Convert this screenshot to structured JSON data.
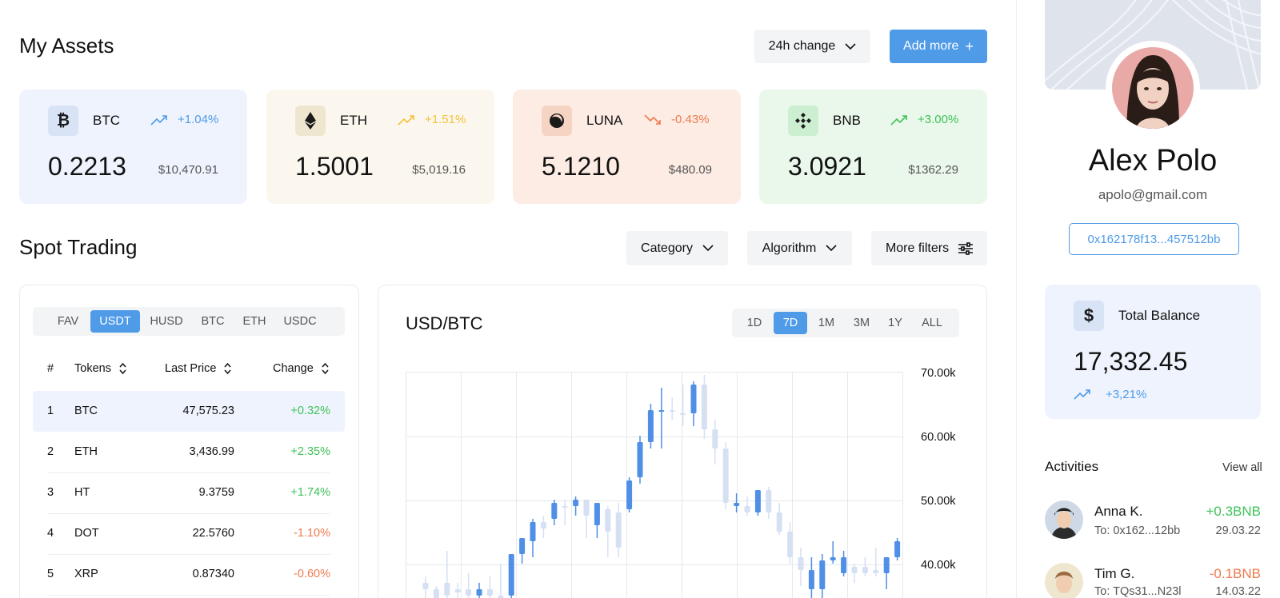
{
  "assets": {
    "title": "My Assets",
    "change_filter": "24h change",
    "add_more": "Add more",
    "cards": [
      {
        "symbol": "BTC",
        "change": "+1.04%",
        "amount": "0.2213",
        "usd": "$10,470.91",
        "icon": "bitcoin-icon",
        "bg": "#eef3fd",
        "icon_bg": "#d8e3f6",
        "accent": "#4f9be8",
        "dir": "up"
      },
      {
        "symbol": "ETH",
        "change": "+1.51%",
        "amount": "1.5001",
        "usd": "$5,019.16",
        "icon": "ethereum-icon",
        "bg": "#fbf7ee",
        "icon_bg": "#efe6d0",
        "accent": "#f3c23b",
        "dir": "up"
      },
      {
        "symbol": "LUNA",
        "change": "-0.43%",
        "amount": "5.1210",
        "usd": "$480.09",
        "icon": "luna-icon",
        "bg": "#fdece4",
        "icon_bg": "#f6d4c4",
        "accent": "#ef7a4f",
        "dir": "down"
      },
      {
        "symbol": "BNB",
        "change": "+3.00%",
        "amount": "3.0921",
        "usd": "$1362.29",
        "icon": "bnb-icon",
        "bg": "#e9f8ea",
        "icon_bg": "#cdefd1",
        "accent": "#3fc25a",
        "dir": "up"
      }
    ]
  },
  "spot": {
    "title": "Spot Trading",
    "filters": {
      "category": "Category",
      "algorithm": "Algorithm",
      "more": "More filters"
    },
    "tabs": [
      "FAV",
      "USDT",
      "HUSD",
      "BTC",
      "ETH",
      "USDC"
    ],
    "active_tab": "USDT",
    "columns": {
      "num": "#",
      "tokens": "Tokens",
      "price": "Last Price",
      "change": "Change"
    },
    "rows": [
      {
        "num": "1",
        "token": "BTC",
        "price": "47,575.23",
        "change": "+0.32%",
        "color": "#3fc25a"
      },
      {
        "num": "2",
        "token": "ETH",
        "price": "3,436.99",
        "change": "+2.35%",
        "color": "#3fc25a"
      },
      {
        "num": "3",
        "token": "HT",
        "price": "9.3759",
        "change": "+1.74%",
        "color": "#3fc25a"
      },
      {
        "num": "4",
        "token": "DOT",
        "price": "22.5760",
        "change": "-1.10%",
        "color": "#ef7a4f"
      },
      {
        "num": "5",
        "token": "XRP",
        "price": "0.87340",
        "change": "-0.60%",
        "color": "#ef7a4f"
      }
    ]
  },
  "chart": {
    "title": "USD/BTC",
    "ranges": [
      "1D",
      "7D",
      "1M",
      "3M",
      "1Y",
      "ALL"
    ],
    "active_range": "7D",
    "y_labels": [
      "70.00k",
      "60.00k",
      "50.00k",
      "40.00k"
    ]
  },
  "chart_data": {
    "type": "candlestick",
    "title": "USD/BTC",
    "ylim": [
      35000,
      70000
    ],
    "y_ticks": [
      "70.00k",
      "60.00k",
      "50.00k",
      "40.00k"
    ],
    "candles": [
      {
        "o": 36000,
        "h": 38000,
        "l": 33000,
        "c": 37000,
        "dir": "down"
      },
      {
        "o": 36000,
        "h": 36500,
        "l": 33000,
        "c": 34000,
        "dir": "down"
      },
      {
        "o": 35000,
        "h": 42000,
        "l": 33000,
        "c": 37000,
        "dir": "down"
      },
      {
        "o": 35500,
        "h": 37000,
        "l": 33000,
        "c": 36000,
        "dir": "down"
      },
      {
        "o": 35000,
        "h": 38500,
        "l": 33000,
        "c": 36000,
        "dir": "down"
      },
      {
        "o": 35000,
        "h": 37000,
        "l": 33000,
        "c": 36000,
        "dir": "up"
      },
      {
        "o": 35000,
        "h": 38000,
        "l": 33000,
        "c": 36000,
        "dir": "down"
      },
      {
        "o": 35000,
        "h": 40000,
        "l": 33000,
        "c": 34000,
        "dir": "down"
      },
      {
        "o": 35000,
        "h": 41500,
        "l": 33000,
        "c": 41500,
        "dir": "up"
      },
      {
        "o": 41500,
        "h": 44000,
        "l": 40000,
        "c": 44000,
        "dir": "up"
      },
      {
        "o": 43500,
        "h": 47000,
        "l": 41000,
        "c": 46500,
        "dir": "up"
      },
      {
        "o": 45500,
        "h": 47500,
        "l": 44000,
        "c": 46500,
        "dir": "down"
      },
      {
        "o": 47000,
        "h": 50000,
        "l": 46000,
        "c": 49500,
        "dir": "up"
      },
      {
        "o": 49000,
        "h": 50000,
        "l": 46000,
        "c": 49000,
        "dir": "down"
      },
      {
        "o": 49000,
        "h": 50500,
        "l": 47500,
        "c": 50000,
        "dir": "up"
      },
      {
        "o": 47500,
        "h": 50000,
        "l": 44000,
        "c": 50000,
        "dir": "down"
      },
      {
        "o": 46000,
        "h": 49500,
        "l": 44000,
        "c": 49500,
        "dir": "up"
      },
      {
        "o": 45000,
        "h": 49000,
        "l": 41000,
        "c": 48500,
        "dir": "down"
      },
      {
        "o": 42500,
        "h": 49500,
        "l": 41000,
        "c": 48000,
        "dir": "down"
      },
      {
        "o": 48500,
        "h": 53500,
        "l": 48000,
        "c": 53000,
        "dir": "up"
      },
      {
        "o": 53500,
        "h": 60000,
        "l": 52500,
        "c": 59000,
        "dir": "up"
      },
      {
        "o": 59000,
        "h": 65000,
        "l": 58000,
        "c": 64000,
        "dir": "up"
      },
      {
        "o": 64000,
        "h": 67500,
        "l": 58000,
        "c": 64000,
        "dir": "up"
      },
      {
        "o": 64000,
        "h": 66000,
        "l": 62500,
        "c": 64000,
        "dir": "down"
      },
      {
        "o": 63500,
        "h": 68000,
        "l": 61500,
        "c": 63500,
        "dir": "down"
      },
      {
        "o": 63500,
        "h": 68500,
        "l": 61500,
        "c": 68000,
        "dir": "up"
      },
      {
        "o": 68000,
        "h": 69500,
        "l": 59500,
        "c": 61000,
        "dir": "down"
      },
      {
        "o": 61000,
        "h": 62500,
        "l": 55500,
        "c": 58000,
        "dir": "down"
      },
      {
        "o": 58000,
        "h": 59000,
        "l": 48500,
        "c": 49500,
        "dir": "down"
      },
      {
        "o": 49500,
        "h": 51000,
        "l": 48000,
        "c": 49000,
        "dir": "up"
      },
      {
        "o": 49000,
        "h": 50500,
        "l": 47500,
        "c": 48000,
        "dir": "down"
      },
      {
        "o": 48000,
        "h": 51500,
        "l": 47500,
        "c": 51500,
        "dir": "up"
      },
      {
        "o": 51500,
        "h": 52000,
        "l": 47000,
        "c": 48000,
        "dir": "down"
      },
      {
        "o": 48000,
        "h": 49500,
        "l": 44500,
        "c": 45000,
        "dir": "down"
      },
      {
        "o": 45000,
        "h": 46500,
        "l": 40000,
        "c": 41000,
        "dir": "down"
      },
      {
        "o": 41000,
        "h": 42500,
        "l": 36500,
        "c": 39000,
        "dir": "down"
      },
      {
        "o": 39000,
        "h": 41000,
        "l": 34500,
        "c": 36000,
        "dir": "up"
      },
      {
        "o": 36000,
        "h": 41500,
        "l": 34500,
        "c": 40500,
        "dir": "up"
      },
      {
        "o": 40500,
        "h": 43500,
        "l": 40000,
        "c": 41000,
        "dir": "up"
      },
      {
        "o": 41000,
        "h": 42000,
        "l": 38000,
        "c": 38500,
        "dir": "up"
      },
      {
        "o": 38500,
        "h": 40000,
        "l": 37000,
        "c": 39500,
        "dir": "down"
      },
      {
        "o": 39500,
        "h": 41000,
        "l": 38000,
        "c": 38500,
        "dir": "down"
      },
      {
        "o": 38500,
        "h": 42500,
        "l": 38000,
        "c": 39000,
        "dir": "down"
      },
      {
        "o": 38500,
        "h": 41000,
        "l": 36000,
        "c": 41000,
        "dir": "up"
      },
      {
        "o": 41000,
        "h": 44000,
        "l": 40500,
        "c": 43500,
        "dir": "up"
      },
      {
        "o": 43500,
        "h": 47500,
        "l": 43000,
        "c": 47000,
        "dir": "up"
      }
    ]
  },
  "profile": {
    "name": "Alex Polo",
    "email": "apolo@gmail.com",
    "wallet": "0x162178f13...457512bb"
  },
  "balance": {
    "label": "Total Balance",
    "currency": "$",
    "amount": "17,332.45",
    "change": "+3,21%"
  },
  "activities": {
    "title": "Activities",
    "view_all": "View all",
    "items": [
      {
        "name": "Anna K.",
        "to": "To: 0x162...12bb",
        "amount": "+0.3BNB",
        "date": "29.03.22",
        "color": "#3fc25a"
      },
      {
        "name": "Tim G.",
        "to": "To: TQs31...N23l",
        "amount": "-0.1BNB",
        "date": "14.03.22",
        "color": "#ef7a4f"
      }
    ]
  }
}
